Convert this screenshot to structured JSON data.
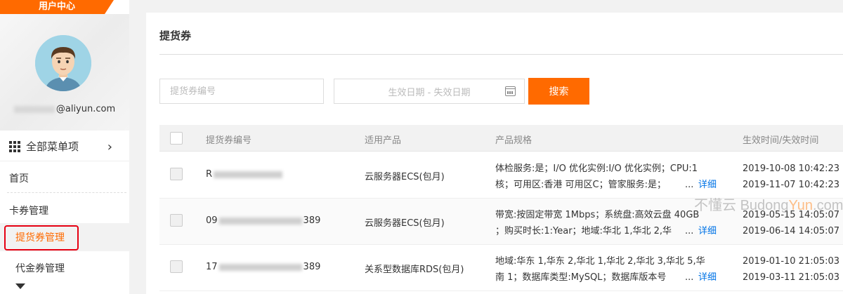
{
  "sidebar": {
    "user_center_label": "用户中心",
    "email_suffix": "@aliyun.com",
    "all_menu_label": "全部菜单项",
    "items": [
      {
        "label": "首页"
      },
      {
        "label": "卡券管理"
      },
      {
        "label": "提货券管理",
        "active": true
      },
      {
        "label": "代金券管理"
      }
    ]
  },
  "main": {
    "title": "提货券",
    "filters": {
      "code_placeholder": "提货券编号",
      "date_range_label": "生效日期 - 失效日期",
      "search_button": "搜索"
    },
    "table": {
      "headers": [
        "提货券编号",
        "适用产品",
        "产品规格",
        "生效时间/失效时间"
      ],
      "rows": [
        {
          "code_prefix": "R",
          "code_suffix": "",
          "product": "云服务器ECS(包月)",
          "spec_line1": "体检服务:是；I/O 优化实例:I/O 优化实例；CPU:1",
          "spec_line2": "核；可用区:香港 可用区C；管家服务:是；",
          "ellipsis": "...",
          "detail": "详细",
          "start": "2019-10-08 10:42:23",
          "end": "2019-11-07 10:42:23"
        },
        {
          "code_prefix": "09",
          "code_suffix": "389",
          "product": "云服务器ECS(包月)",
          "spec_line1": "带宽:按固定带宽 1Mbps；系统盘:高效云盘 40GB",
          "spec_line2": "；购买时长:1:Year；地域:华北 1,华北 2,华",
          "ellipsis": "...",
          "detail": "详细",
          "start": "2019-05-15 14:05:07",
          "end": "2019-06-14 14:05:07"
        },
        {
          "code_prefix": "17",
          "code_suffix": "389",
          "product": "关系型数据库RDS(包月)",
          "spec_line1": "地域:华东 1,华东 2,华北 1,华北 2,华北 3,华北 5,华",
          "spec_line2": "南 1；数据库类型:MySQL；数据库版本号",
          "ellipsis": "...",
          "detail": "详细",
          "start": "2019-01-10 21:05:03",
          "end": "2019-03-11 21:05:03"
        }
      ]
    }
  },
  "watermark": {
    "cn": "不懂云",
    "en_a": "Budong",
    "en_b": "Yun",
    "en_c": ".com"
  },
  "colors": {
    "accent": "#ff6a00",
    "link": "#0073e6",
    "active_border": "#e60012"
  },
  "icons": [
    "grid-icon",
    "chevron-right-icon",
    "calendar-icon",
    "caret-down-icon",
    "avatar"
  ]
}
